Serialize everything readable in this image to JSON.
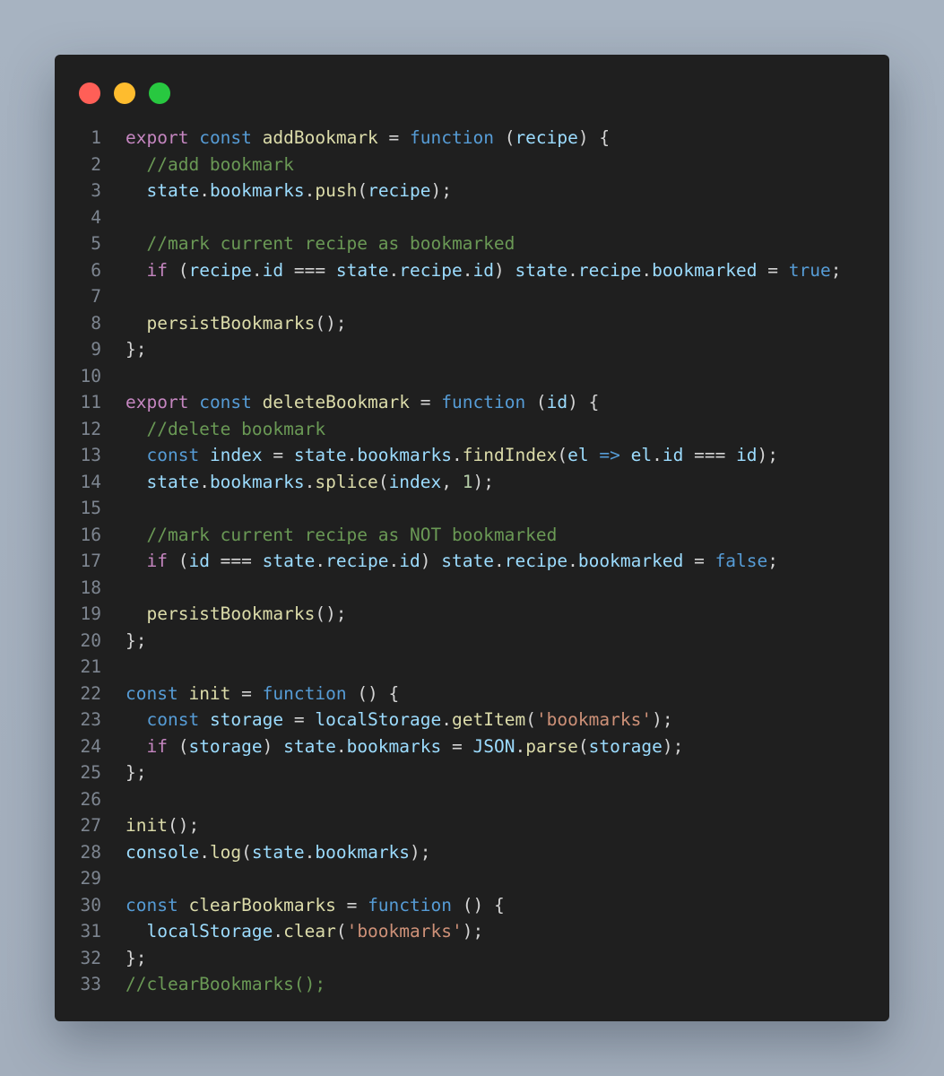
{
  "window": {
    "controls": [
      "close",
      "minimize",
      "maximize"
    ],
    "colors": {
      "background": "#1f1f1f",
      "close": "#ff5f57",
      "minimize": "#febc2e",
      "maximize": "#28c840"
    }
  },
  "code": {
    "language": "javascript",
    "lines": [
      [
        [
          "kw",
          "export"
        ],
        [
          "p",
          " "
        ],
        [
          "st",
          "const"
        ],
        [
          "p",
          " "
        ],
        [
          "fn",
          "addBookmark"
        ],
        [
          "p",
          " = "
        ],
        [
          "st",
          "function"
        ],
        [
          "p",
          " ("
        ],
        [
          "var",
          "recipe"
        ],
        [
          "p",
          ") {"
        ]
      ],
      [
        [
          "p",
          "  "
        ],
        [
          "cm",
          "//add bookmark"
        ]
      ],
      [
        [
          "p",
          "  "
        ],
        [
          "var",
          "state"
        ],
        [
          "p",
          "."
        ],
        [
          "var",
          "bookmarks"
        ],
        [
          "p",
          "."
        ],
        [
          "fn",
          "push"
        ],
        [
          "p",
          "("
        ],
        [
          "var",
          "recipe"
        ],
        [
          "p",
          ");"
        ]
      ],
      [],
      [
        [
          "p",
          "  "
        ],
        [
          "cm",
          "//mark current recipe as bookmarked"
        ]
      ],
      [
        [
          "p",
          "  "
        ],
        [
          "kw",
          "if"
        ],
        [
          "p",
          " ("
        ],
        [
          "var",
          "recipe"
        ],
        [
          "p",
          "."
        ],
        [
          "var",
          "id"
        ],
        [
          "p",
          " === "
        ],
        [
          "var",
          "state"
        ],
        [
          "p",
          "."
        ],
        [
          "var",
          "recipe"
        ],
        [
          "p",
          "."
        ],
        [
          "var",
          "id"
        ],
        [
          "p",
          ") "
        ],
        [
          "var",
          "state"
        ],
        [
          "p",
          "."
        ],
        [
          "var",
          "recipe"
        ],
        [
          "p",
          "."
        ],
        [
          "var",
          "bookmarked"
        ],
        [
          "p",
          " = "
        ],
        [
          "st",
          "true"
        ],
        [
          "p",
          ";"
        ]
      ],
      [],
      [
        [
          "p",
          "  "
        ],
        [
          "fn",
          "persistBookmarks"
        ],
        [
          "p",
          "();"
        ]
      ],
      [
        [
          "p",
          "};"
        ]
      ],
      [],
      [
        [
          "kw",
          "export"
        ],
        [
          "p",
          " "
        ],
        [
          "st",
          "const"
        ],
        [
          "p",
          " "
        ],
        [
          "fn",
          "deleteBookmark"
        ],
        [
          "p",
          " = "
        ],
        [
          "st",
          "function"
        ],
        [
          "p",
          " ("
        ],
        [
          "var",
          "id"
        ],
        [
          "p",
          ") {"
        ]
      ],
      [
        [
          "p",
          "  "
        ],
        [
          "cm",
          "//delete bookmark"
        ]
      ],
      [
        [
          "p",
          "  "
        ],
        [
          "st",
          "const"
        ],
        [
          "p",
          " "
        ],
        [
          "var",
          "index"
        ],
        [
          "p",
          " = "
        ],
        [
          "var",
          "state"
        ],
        [
          "p",
          "."
        ],
        [
          "var",
          "bookmarks"
        ],
        [
          "p",
          "."
        ],
        [
          "fn",
          "findIndex"
        ],
        [
          "p",
          "("
        ],
        [
          "var",
          "el"
        ],
        [
          "p",
          " "
        ],
        [
          "st",
          "=>"
        ],
        [
          "p",
          " "
        ],
        [
          "var",
          "el"
        ],
        [
          "p",
          "."
        ],
        [
          "var",
          "id"
        ],
        [
          "p",
          " === "
        ],
        [
          "var",
          "id"
        ],
        [
          "p",
          ");"
        ]
      ],
      [
        [
          "p",
          "  "
        ],
        [
          "var",
          "state"
        ],
        [
          "p",
          "."
        ],
        [
          "var",
          "bookmarks"
        ],
        [
          "p",
          "."
        ],
        [
          "fn",
          "splice"
        ],
        [
          "p",
          "("
        ],
        [
          "var",
          "index"
        ],
        [
          "p",
          ", "
        ],
        [
          "num",
          "1"
        ],
        [
          "p",
          ");"
        ]
      ],
      [],
      [
        [
          "p",
          "  "
        ],
        [
          "cm",
          "//mark current recipe as NOT bookmarked"
        ]
      ],
      [
        [
          "p",
          "  "
        ],
        [
          "kw",
          "if"
        ],
        [
          "p",
          " ("
        ],
        [
          "var",
          "id"
        ],
        [
          "p",
          " === "
        ],
        [
          "var",
          "state"
        ],
        [
          "p",
          "."
        ],
        [
          "var",
          "recipe"
        ],
        [
          "p",
          "."
        ],
        [
          "var",
          "id"
        ],
        [
          "p",
          ") "
        ],
        [
          "var",
          "state"
        ],
        [
          "p",
          "."
        ],
        [
          "var",
          "recipe"
        ],
        [
          "p",
          "."
        ],
        [
          "var",
          "bookmarked"
        ],
        [
          "p",
          " = "
        ],
        [
          "st",
          "false"
        ],
        [
          "p",
          ";"
        ]
      ],
      [],
      [
        [
          "p",
          "  "
        ],
        [
          "fn",
          "persistBookmarks"
        ],
        [
          "p",
          "();"
        ]
      ],
      [
        [
          "p",
          "};"
        ]
      ],
      [],
      [
        [
          "st",
          "const"
        ],
        [
          "p",
          " "
        ],
        [
          "fn",
          "init"
        ],
        [
          "p",
          " = "
        ],
        [
          "st",
          "function"
        ],
        [
          "p",
          " () {"
        ]
      ],
      [
        [
          "p",
          "  "
        ],
        [
          "st",
          "const"
        ],
        [
          "p",
          " "
        ],
        [
          "var",
          "storage"
        ],
        [
          "p",
          " = "
        ],
        [
          "var",
          "localStorage"
        ],
        [
          "p",
          "."
        ],
        [
          "fn",
          "getItem"
        ],
        [
          "p",
          "("
        ],
        [
          "str",
          "'bookmarks'"
        ],
        [
          "p",
          ");"
        ]
      ],
      [
        [
          "p",
          "  "
        ],
        [
          "kw",
          "if"
        ],
        [
          "p",
          " ("
        ],
        [
          "var",
          "storage"
        ],
        [
          "p",
          ") "
        ],
        [
          "var",
          "state"
        ],
        [
          "p",
          "."
        ],
        [
          "var",
          "bookmarks"
        ],
        [
          "p",
          " = "
        ],
        [
          "var",
          "JSON"
        ],
        [
          "p",
          "."
        ],
        [
          "fn",
          "parse"
        ],
        [
          "p",
          "("
        ],
        [
          "var",
          "storage"
        ],
        [
          "p",
          ");"
        ]
      ],
      [
        [
          "p",
          "};"
        ]
      ],
      [],
      [
        [
          "fn",
          "init"
        ],
        [
          "p",
          "();"
        ]
      ],
      [
        [
          "var",
          "console"
        ],
        [
          "p",
          "."
        ],
        [
          "fn",
          "log"
        ],
        [
          "p",
          "("
        ],
        [
          "var",
          "state"
        ],
        [
          "p",
          "."
        ],
        [
          "var",
          "bookmarks"
        ],
        [
          "p",
          ");"
        ]
      ],
      [],
      [
        [
          "st",
          "const"
        ],
        [
          "p",
          " "
        ],
        [
          "fn",
          "clearBookmarks"
        ],
        [
          "p",
          " = "
        ],
        [
          "st",
          "function"
        ],
        [
          "p",
          " () {"
        ]
      ],
      [
        [
          "p",
          "  "
        ],
        [
          "var",
          "localStorage"
        ],
        [
          "p",
          "."
        ],
        [
          "fn",
          "clear"
        ],
        [
          "p",
          "("
        ],
        [
          "str",
          "'bookmarks'"
        ],
        [
          "p",
          ");"
        ]
      ],
      [
        [
          "p",
          "};"
        ]
      ],
      [
        [
          "cm",
          "//clearBookmarks();"
        ]
      ]
    ]
  }
}
